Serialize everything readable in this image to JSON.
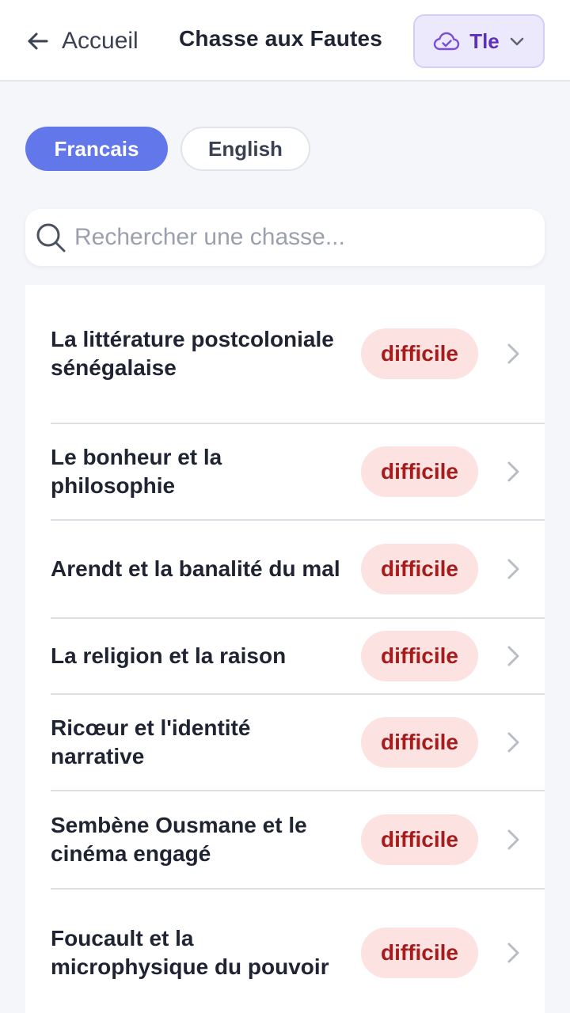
{
  "header": {
    "back_label": "Accueil",
    "title": "Chasse aux Fautes",
    "level_label": "Tle",
    "accent_color": "#5b2fbf"
  },
  "language_tabs": [
    {
      "label": "Francais",
      "active": true
    },
    {
      "label": "English",
      "active": false
    }
  ],
  "search": {
    "value": "",
    "placeholder": "Rechercher une chasse..."
  },
  "hunts": [
    {
      "title": "La littérature postcoloniale sénégalaise",
      "difficulty": "difficile"
    },
    {
      "title": "Le bonheur et la philosophie",
      "difficulty": "difficile"
    },
    {
      "title": "Arendt et la banalité du mal",
      "difficulty": "difficile"
    },
    {
      "title": "La religion et la raison",
      "difficulty": "difficile"
    },
    {
      "title": "Ricœur et l'identité narrative",
      "difficulty": "difficile"
    },
    {
      "title": "Sembène Ousmane et le cinéma engagé",
      "difficulty": "difficile"
    },
    {
      "title": "Foucault et la microphysique du pouvoir",
      "difficulty": "difficile"
    }
  ],
  "icons": {
    "back": "arrow-left-icon",
    "level": "cloud-icon",
    "dropdown": "chevron-down-icon",
    "search": "search-icon",
    "row": "chevron-right-icon"
  }
}
